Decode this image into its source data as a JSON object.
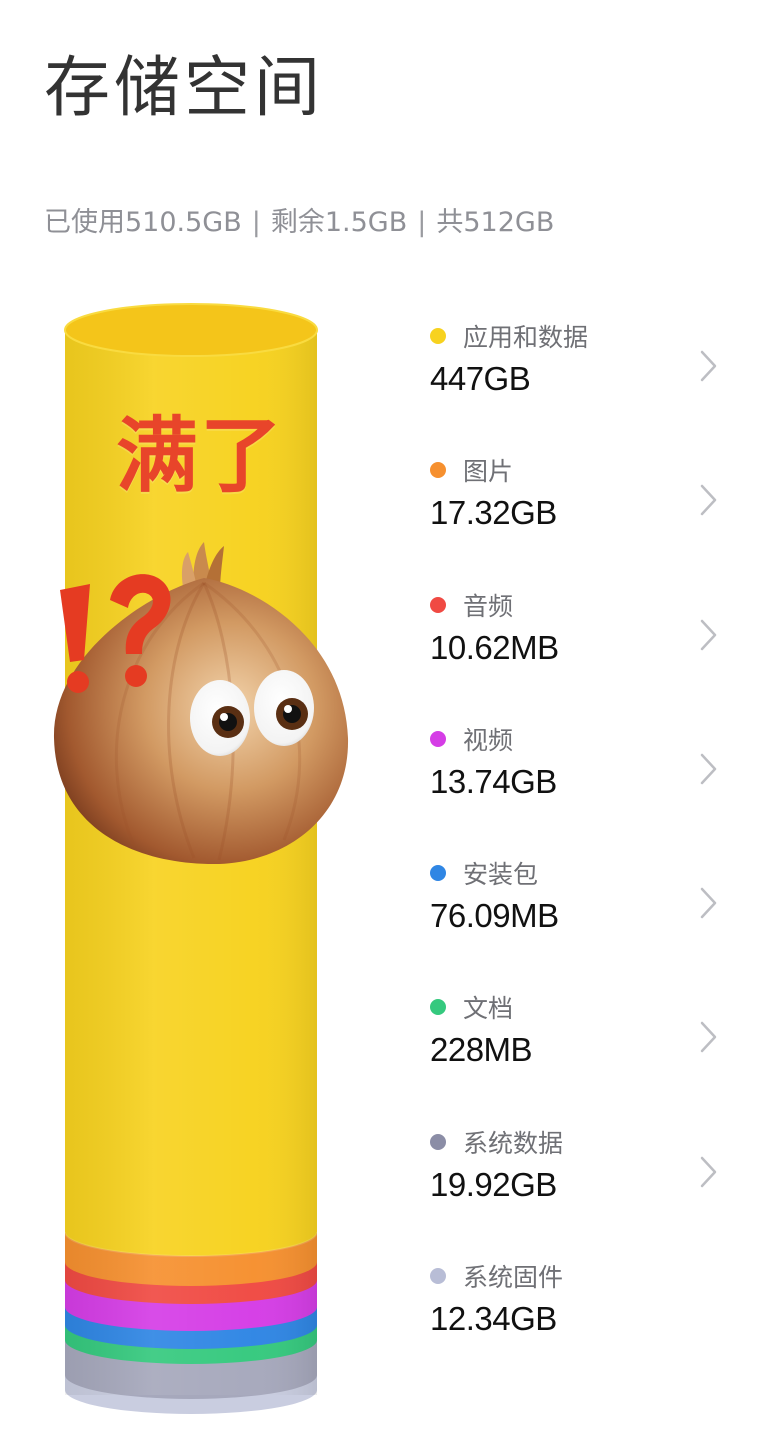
{
  "page": {
    "title": "存储空间",
    "summary": {
      "used": "已使用510.5GB",
      "free": "剩余1.5GB",
      "total": "共512GB",
      "separator": "|"
    }
  },
  "overlay": {
    "caption": "满了",
    "sticker_icon": "surprised-onion-icon",
    "exclaim_icon": "exclamation-question-icon"
  },
  "colors": {
    "apps": "#f7d21f",
    "images": "#f6902f",
    "audio": "#f04a43",
    "video": "#d53de6",
    "apk": "#2f86e4",
    "docs": "#35c97e",
    "system_data": "#8b8da6",
    "firmware": "#b8bdd6",
    "caption": "#e8452a"
  },
  "categories": [
    {
      "label": "应用和数据",
      "size": "447GB",
      "color": "#f7d21f",
      "chevron": true
    },
    {
      "label": "图片",
      "size": "17.32GB",
      "color": "#f6902f",
      "chevron": true
    },
    {
      "label": "音频",
      "size": "10.62MB",
      "color": "#f04a43",
      "chevron": true
    },
    {
      "label": "视频",
      "size": "13.74GB",
      "color": "#d53de6",
      "chevron": true
    },
    {
      "label": "安装包",
      "size": "76.09MB",
      "color": "#2f86e4",
      "chevron": true
    },
    {
      "label": "文档",
      "size": "228MB",
      "color": "#35c97e",
      "chevron": true
    },
    {
      "label": "系统数据",
      "size": "19.92GB",
      "color": "#8b8da6",
      "chevron": true
    },
    {
      "label": "系统固件",
      "size": "12.34GB",
      "color": "#b8bdd6",
      "chevron": false
    }
  ]
}
